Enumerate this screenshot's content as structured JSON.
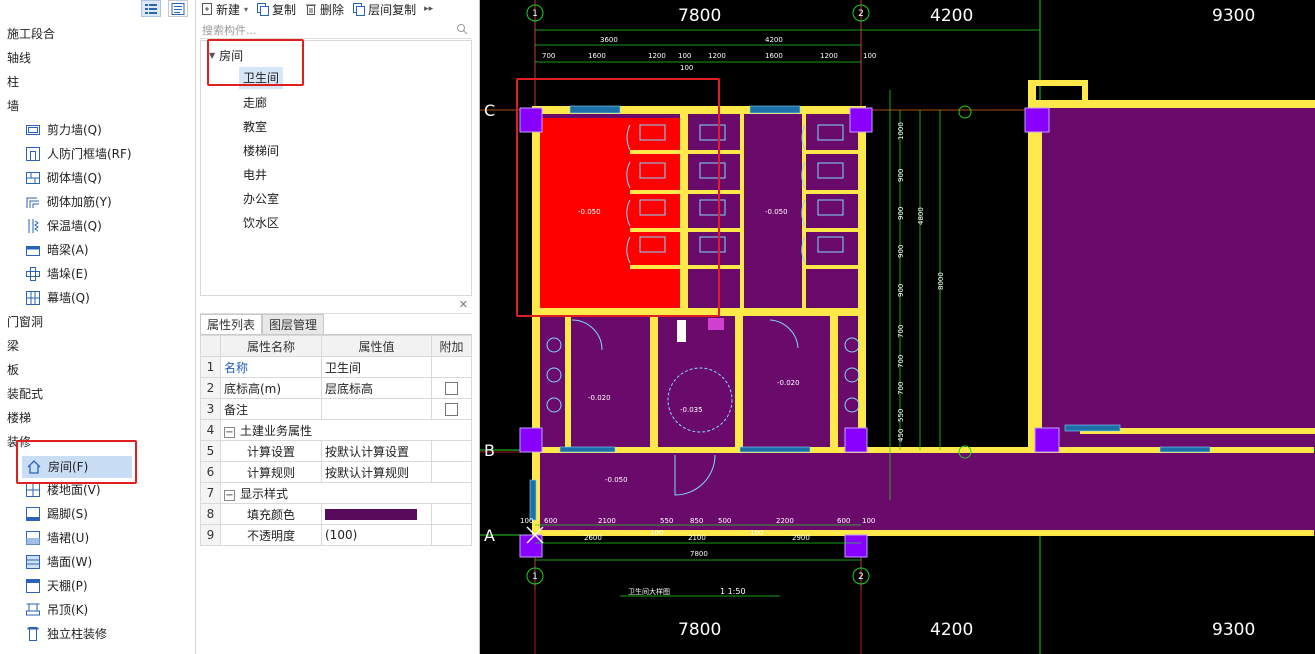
{
  "nav": {
    "items": [
      {
        "label": "施工段合",
        "type": "cat"
      },
      {
        "label": "轴线",
        "type": "cat"
      },
      {
        "label": "柱",
        "type": "cat"
      },
      {
        "label": "墙",
        "type": "cat"
      },
      {
        "label": "剪力墙(Q)",
        "type": "sub",
        "icon": "shear-wall-icon"
      },
      {
        "label": "人防门框墙(RF)",
        "type": "sub",
        "icon": "civil-defense-wall-icon"
      },
      {
        "label": "砌体墙(Q)",
        "type": "sub",
        "icon": "masonry-wall-icon"
      },
      {
        "label": "砌体加筋(Y)",
        "type": "sub",
        "icon": "masonry-rebar-icon"
      },
      {
        "label": "保温墙(Q)",
        "type": "sub",
        "icon": "insulation-wall-icon"
      },
      {
        "label": "暗梁(A)",
        "type": "sub",
        "icon": "hidden-beam-icon"
      },
      {
        "label": "墙垛(E)",
        "type": "sub",
        "icon": "wall-pier-icon"
      },
      {
        "label": "幕墙(Q)",
        "type": "sub",
        "icon": "curtain-wall-icon"
      },
      {
        "label": "门窗洞",
        "type": "cat"
      },
      {
        "label": "梁",
        "type": "cat"
      },
      {
        "label": "板",
        "type": "cat"
      },
      {
        "label": "装配式",
        "type": "cat"
      },
      {
        "label": "楼梯",
        "type": "cat"
      },
      {
        "label": "装修",
        "type": "cat"
      },
      {
        "label": "房间(F)",
        "type": "sub",
        "icon": "house-icon",
        "selected": true
      },
      {
        "label": "楼地面(V)",
        "type": "sub",
        "icon": "floor-icon"
      },
      {
        "label": "踢脚(S)",
        "type": "sub",
        "icon": "skirting-icon"
      },
      {
        "label": "墙裙(U)",
        "type": "sub",
        "icon": "wainscot-icon"
      },
      {
        "label": "墙面(W)",
        "type": "sub",
        "icon": "wall-face-icon"
      },
      {
        "label": "天棚(P)",
        "type": "sub",
        "icon": "ceiling-icon"
      },
      {
        "label": "吊顶(K)",
        "type": "sub",
        "icon": "suspended-ceiling-icon"
      },
      {
        "label": "独立柱装修",
        "type": "sub",
        "icon": "column-finish-icon"
      }
    ]
  },
  "toolbar": {
    "new_label": "新建",
    "copy_label": "复制",
    "delete_label": "删除",
    "floor_copy_label": "层间复制"
  },
  "search": {
    "placeholder": "搜索构件..."
  },
  "tree": {
    "root": "房间",
    "items": [
      "卫生间",
      "走廊",
      "教室",
      "楼梯间",
      "电井",
      "办公室",
      "饮水区"
    ],
    "selected_index": 0
  },
  "props": {
    "tabs": [
      "属性列表",
      "图层管理"
    ],
    "headers": [
      "属性名称",
      "属性值",
      "附加"
    ],
    "rows": [
      {
        "num": "1",
        "name": "名称",
        "value": "卫生间",
        "check": false,
        "blue": true
      },
      {
        "num": "2",
        "name": "底标高(m)",
        "value": "层底标高",
        "check": true
      },
      {
        "num": "3",
        "name": "备注",
        "value": "",
        "check": true
      },
      {
        "num": "4",
        "name": "土建业务属性",
        "value": "",
        "group": true
      },
      {
        "num": "5",
        "name": "计算设置",
        "value": "按默认计算设置",
        "child": true
      },
      {
        "num": "6",
        "name": "计算规则",
        "value": "按默认计算规则",
        "child": true
      },
      {
        "num": "7",
        "name": "显示样式",
        "value": "",
        "group": true
      },
      {
        "num": "8",
        "name": "填充颜色",
        "value": "",
        "child": true,
        "swatch": "#5a0a5a"
      },
      {
        "num": "9",
        "name": "不透明度",
        "value": "(100)",
        "child": true
      }
    ]
  },
  "cad": {
    "top_dims": [
      "7800",
      "4200",
      "9300"
    ],
    "bottom_dims": [
      "7800",
      "4200",
      "9300"
    ],
    "axis_rows": [
      "C",
      "B",
      "A"
    ],
    "axis_cols": [
      "1",
      "2"
    ],
    "room_fill": "#6a0a6a",
    "highlight_fill": "#ff0000",
    "wall_color": "#ffe94a",
    "grid_color": "#20d020",
    "small_dims_top": [
      "3600",
      "4200",
      "700",
      "1600",
      "1200",
      "100",
      "1200",
      "1600",
      "1200",
      "100",
      "100"
    ],
    "small_dims_bottom": [
      "100",
      "600",
      "2100",
      "550",
      "850",
      "500",
      "2200",
      "600",
      "100",
      "2600",
      "100",
      "2100",
      "100",
      "2900",
      "100",
      "7800"
    ],
    "side_dims": [
      "1000",
      "900",
      "900",
      "900",
      "900",
      "700",
      "700",
      "700",
      "550",
      "450",
      "4800",
      "8000"
    ],
    "elev_labels": [
      "-0.050",
      "-0.050",
      "-0.020",
      "-0.020",
      "-0.035",
      "-0.050"
    ],
    "title_label": "卫生间大样图",
    "scale_label": "1 1:50"
  }
}
